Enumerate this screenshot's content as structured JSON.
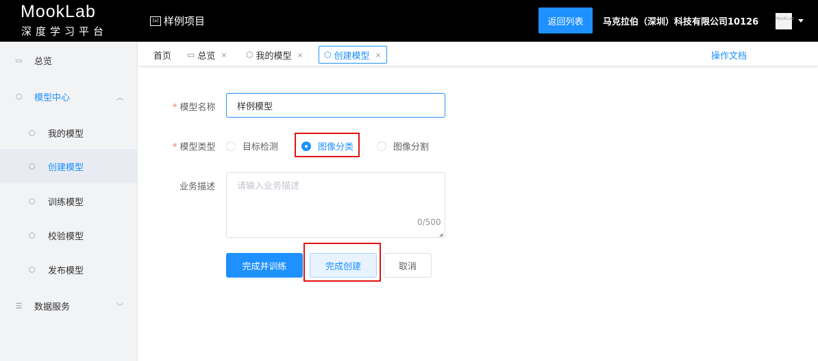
{
  "header": {
    "logo_title": "MookLab",
    "logo_subtitle": "深度学习平台",
    "project_icon": "[a]",
    "project_name": "样例项目",
    "back_button": "返回列表",
    "company": "马克拉伯（深圳）科技有限公司10126",
    "avatar_text": "MookLab",
    "caret_icon": "caret-down-icon"
  },
  "sidebar": {
    "items": [
      {
        "label": "总览",
        "icon": "overview-icon"
      },
      {
        "label": "模型中心",
        "icon": "cube-icon",
        "arrow": "chevron-up-icon"
      },
      {
        "label": "我的模型",
        "icon": "cube-icon"
      },
      {
        "label": "创建模型",
        "icon": "cube-icon"
      },
      {
        "label": "训练模型",
        "icon": "cube-icon"
      },
      {
        "label": "校验模型",
        "icon": "cube-check-icon"
      },
      {
        "label": "发布模型",
        "icon": "cube-publish-icon"
      },
      {
        "label": "数据服务",
        "icon": "database-icon",
        "arrow": "chevron-down-icon"
      }
    ]
  },
  "tabs": {
    "items": [
      {
        "label": "首页"
      },
      {
        "label": "总览",
        "close": "×"
      },
      {
        "label": "我的模型",
        "close": "×"
      },
      {
        "label": "创建模型",
        "close": "×"
      }
    ],
    "doc_link": "操作文档"
  },
  "form": {
    "required_mark": "*",
    "name_label": "模型名称",
    "name_value": "样例模型",
    "type_label": "模型类型",
    "type_options": [
      "目标检测",
      "图像分类",
      "图像分割"
    ],
    "type_selected": "图像分类",
    "desc_label": "业务描述",
    "desc_placeholder": "请输入业务描述",
    "desc_counter": "0/500",
    "btn_finish_train": "完成并训练",
    "btn_finish_create": "完成创建",
    "btn_cancel": "取消"
  },
  "colors": {
    "accent": "#1e90ff",
    "header_bg": "#000000",
    "sidebar_bg": "#f2f3f5",
    "highlight": "#e01010"
  }
}
